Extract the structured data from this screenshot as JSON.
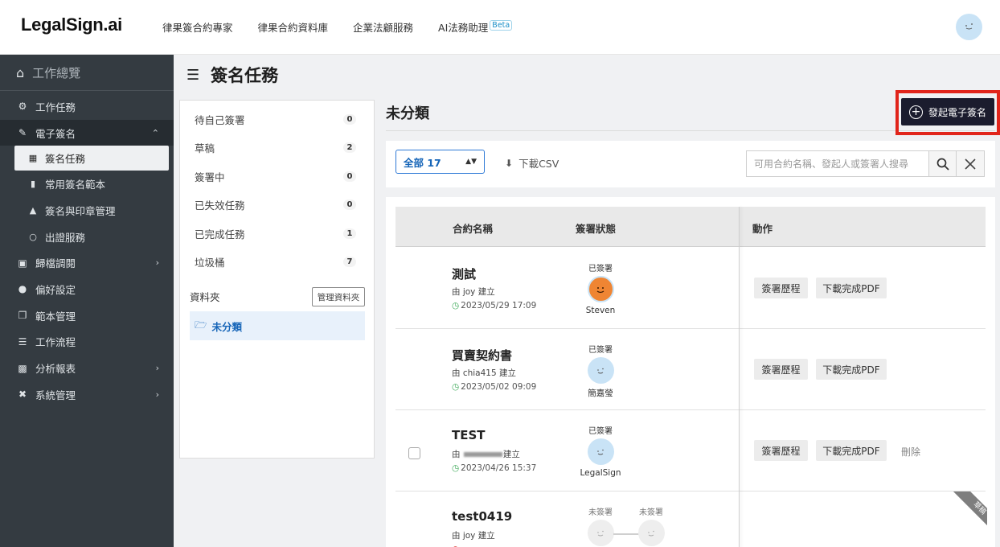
{
  "brand": {
    "logo": "LegalSign.ai"
  },
  "topnav": {
    "links": [
      "律果簽合約專家",
      "律果合約資料庫",
      "企業法顧服務",
      "AI法務助理"
    ],
    "beta": "Beta"
  },
  "sidebar": {
    "overview": "工作總覽",
    "tasks": "工作任務",
    "esign": "電子簽名",
    "esign_sub": [
      "簽名任務",
      "常用簽名範本",
      "簽名與印章管理",
      "出證服務"
    ],
    "archive": "歸檔調閱",
    "prefs": "偏好設定",
    "templates": "範本管理",
    "workflow": "工作流程",
    "reports": "分析報表",
    "system": "系統管理"
  },
  "page": {
    "title": "簽名任務"
  },
  "categories": [
    {
      "label": "待自己簽署",
      "count": "0"
    },
    {
      "label": "草稿",
      "count": "2"
    },
    {
      "label": "簽署中",
      "count": "0"
    },
    {
      "label": "已失效任務",
      "count": "0"
    },
    {
      "label": "已完成任務",
      "count": "1"
    },
    {
      "label": "垃圾桶",
      "count": "7"
    }
  ],
  "folders": {
    "label": "資料夾",
    "manage": "管理資料夾",
    "current": "未分類"
  },
  "main": {
    "title": "未分類",
    "new_sign": "發起電子簽名",
    "filter": "全部 17",
    "download_csv": "下載CSV",
    "search_placeholder": "可用合約名稱、發起人或簽署人搜尋"
  },
  "table": {
    "headers": {
      "name": "合約名稱",
      "status": "簽署狀態",
      "actions": "動作"
    },
    "rows": [
      {
        "name": "測試",
        "by": "由 joy 建立",
        "date": "2023/05/29 17:09",
        "signer_status": "已簽署",
        "signer_name": "Steven",
        "act1": "簽署歷程",
        "act2": "下載完成PDF"
      },
      {
        "name": "買賣契約書",
        "by": "由 chia415 建立",
        "date": "2023/05/02 09:09",
        "signer_status": "已簽署",
        "signer_name": "簡嘉瑩",
        "act1": "簽署歷程",
        "act2": "下載完成PDF"
      },
      {
        "name": "TEST",
        "by_prefix": "由",
        "by_suffix": "建立",
        "date": "2023/04/26 15:37",
        "signer_status": "已簽署",
        "signer_name": "LegalSign",
        "act1": "簽署歷程",
        "act2": "下載完成PDF",
        "act3": "刪除"
      },
      {
        "name": "test0419",
        "by": "由 joy 建立",
        "signer1_status": "未簽署",
        "signer2_status": "未簽署",
        "ribbon": "草稿"
      }
    ]
  },
  "colors": {
    "sidebar": "#343b41",
    "primary_button": "#1b1c2e",
    "highlight": "#e1251b",
    "link_blue": "#1665b8"
  }
}
